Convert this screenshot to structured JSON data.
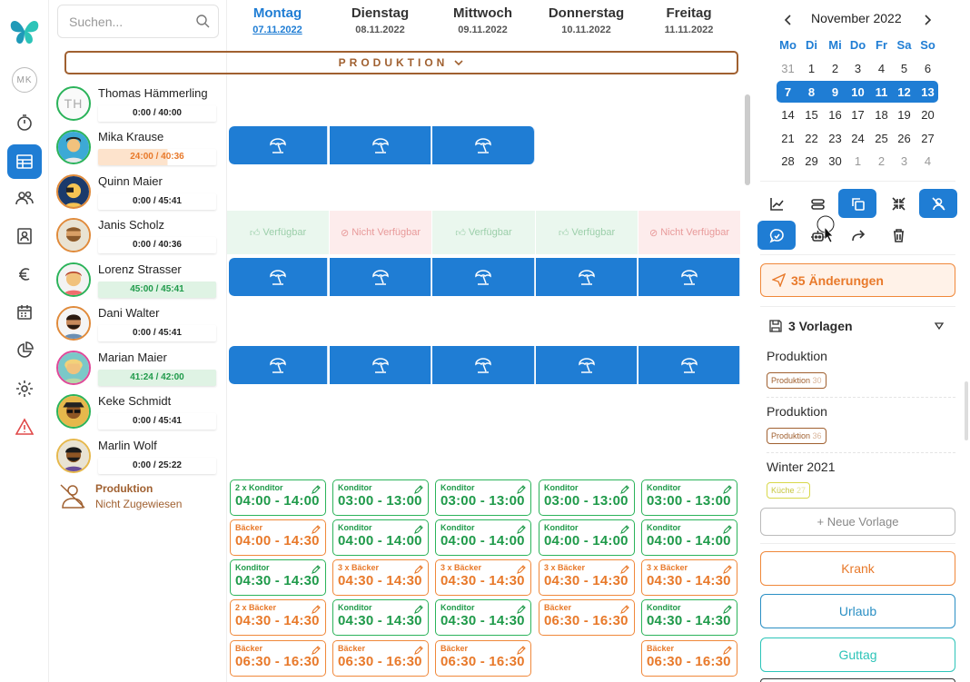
{
  "search": {
    "placeholder": "Suchen..."
  },
  "rail": {
    "avatar_initials": "MK"
  },
  "days": [
    {
      "name": "Montag",
      "date": "07.11.2022"
    },
    {
      "name": "Dienstag",
      "date": "08.11.2022"
    },
    {
      "name": "Mittwoch",
      "date": "09.11.2022"
    },
    {
      "name": "Donnerstag",
      "date": "10.11.2022"
    },
    {
      "name": "Freitag",
      "date": "11.11.2022"
    }
  ],
  "banner": {
    "label": "PRODUKTION"
  },
  "employees": [
    {
      "name": "Thomas Hämmerling",
      "hours": "0:00 / 40:00",
      "initials": "TH"
    },
    {
      "name": "Mika Krause",
      "hours": "24:00 / 40:36"
    },
    {
      "name": "Quinn Maier",
      "hours": "0:00 / 45:41"
    },
    {
      "name": "Janis Scholz",
      "hours": "0:00 / 40:36"
    },
    {
      "name": "Lorenz Strasser",
      "hours": "45:00 / 45:41"
    },
    {
      "name": "Dani Walter",
      "hours": "0:00 / 45:41"
    },
    {
      "name": "Marian Maier",
      "hours": "41:24 / 42:00"
    },
    {
      "name": "Keke Schmidt",
      "hours": "0:00 / 45:41"
    },
    {
      "name": "Marlin Wolf",
      "hours": "0:00 / 25:22"
    }
  ],
  "availability": [
    "Verfügbar",
    "Nicht Verfügbar",
    "Verfügbar",
    "Verfügbar",
    "Nicht Verfügbar"
  ],
  "unassigned": {
    "title": "Produktion",
    "subtitle": "Nicht Zugewiesen"
  },
  "shifts": [
    [
      {
        "label": "2 x Konditor",
        "time": "04:00 - 14:00",
        "color": "g"
      },
      {
        "label": "Bäcker",
        "time": "04:00 - 14:30",
        "color": "o"
      },
      {
        "label": "Konditor",
        "time": "04:30 - 14:30",
        "color": "g"
      },
      {
        "label": "2 x Bäcker",
        "time": "04:30 - 14:30",
        "color": "o"
      },
      {
        "label": "Bäcker",
        "time": "06:30 - 16:30",
        "color": "o"
      }
    ],
    [
      {
        "label": "Konditor",
        "time": "03:00 - 13:00",
        "color": "g"
      },
      {
        "label": "Konditor",
        "time": "04:00 - 14:00",
        "color": "g"
      },
      {
        "label": "3 x Bäcker",
        "time": "04:30 - 14:30",
        "color": "o"
      },
      {
        "label": "Konditor",
        "time": "04:30 - 14:30",
        "color": "g"
      },
      {
        "label": "Bäcker",
        "time": "06:30 - 16:30",
        "color": "o"
      }
    ],
    [
      {
        "label": "Konditor",
        "time": "03:00 - 13:00",
        "color": "g"
      },
      {
        "label": "Konditor",
        "time": "04:00 - 14:00",
        "color": "g"
      },
      {
        "label": "3 x Bäcker",
        "time": "04:30 - 14:30",
        "color": "o"
      },
      {
        "label": "Konditor",
        "time": "04:30 - 14:30",
        "color": "g"
      },
      {
        "label": "Bäcker",
        "time": "06:30 - 16:30",
        "color": "o"
      }
    ],
    [
      {
        "label": "Konditor",
        "time": "03:00 - 13:00",
        "color": "g"
      },
      {
        "label": "Konditor",
        "time": "04:00 - 14:00",
        "color": "g"
      },
      {
        "label": "3 x Bäcker",
        "time": "04:30 - 14:30",
        "color": "o"
      },
      {
        "label": "Bäcker",
        "time": "06:30 - 16:30",
        "color": "o"
      }
    ],
    [
      {
        "label": "Konditor",
        "time": "03:00 - 13:00",
        "color": "g"
      },
      {
        "label": "Konditor",
        "time": "04:00 - 14:00",
        "color": "g"
      },
      {
        "label": "3 x Bäcker",
        "time": "04:30 - 14:30",
        "color": "o"
      },
      {
        "label": "Konditor",
        "time": "04:30 - 14:30",
        "color": "g"
      },
      {
        "label": "Bäcker",
        "time": "06:30 - 16:30",
        "color": "o"
      }
    ]
  ],
  "calendar": {
    "month": "November 2022",
    "weekdays": [
      "Mo",
      "Di",
      "Mi",
      "Do",
      "Fr",
      "Sa",
      "So"
    ],
    "weeks": [
      [
        "31",
        "1",
        "2",
        "3",
        "4",
        "5",
        "6"
      ],
      [
        "7",
        "8",
        "9",
        "10",
        "11",
        "12",
        "13"
      ],
      [
        "14",
        "15",
        "16",
        "17",
        "18",
        "19",
        "20"
      ],
      [
        "21",
        "22",
        "23",
        "24",
        "25",
        "26",
        "27"
      ],
      [
        "28",
        "29",
        "30",
        "1",
        "2",
        "3",
        "4"
      ]
    ]
  },
  "changes": {
    "label": "35 Änderungen"
  },
  "templates": {
    "header": "3 Vorlagen",
    "items": [
      {
        "name": "Produktion",
        "tag": "Produktion",
        "count": "30"
      },
      {
        "name": "Produktion",
        "tag": "Produktion",
        "count": "36"
      },
      {
        "name": "Winter 2021",
        "tag": "Küche",
        "count": "27"
      }
    ],
    "new_label": "+ Neue Vorlage"
  },
  "actions": {
    "sick": "Krank",
    "vacation": "Urlaub",
    "credit": "Guttag"
  },
  "colors": {
    "accent": "#1f7dd4",
    "brown": "#a06030",
    "green": "#2bb35a",
    "orange": "#f0883a",
    "red": "#e04848",
    "teal": "#2cc4b8"
  }
}
